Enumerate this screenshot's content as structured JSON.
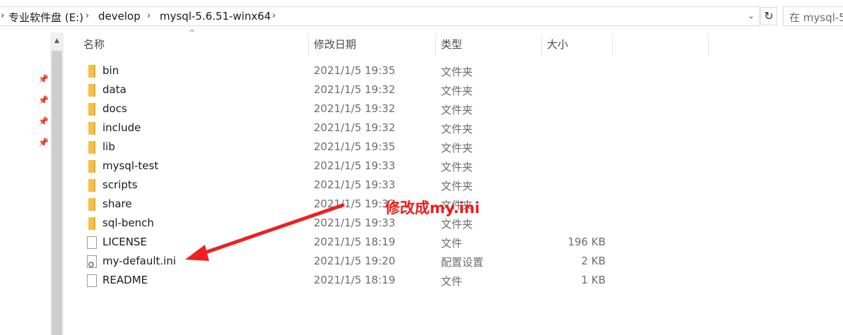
{
  "breadcrumb": {
    "items": [
      "专业软件盘 (E:)",
      "develop",
      "mysql-5.6.51-winx64"
    ]
  },
  "search": {
    "placeholder": "在 mysql-5"
  },
  "columns": {
    "name": "名称",
    "date": "修改日期",
    "type": "类型",
    "size": "大小"
  },
  "rows": [
    {
      "name": "bin",
      "date": "2021/1/5 19:35",
      "type": "文件夹",
      "size": "",
      "icon": "folder-icon"
    },
    {
      "name": "data",
      "date": "2021/1/5 19:32",
      "type": "文件夹",
      "size": "",
      "icon": "folder-icon"
    },
    {
      "name": "docs",
      "date": "2021/1/5 19:32",
      "type": "文件夹",
      "size": "",
      "icon": "folder-icon"
    },
    {
      "name": "include",
      "date": "2021/1/5 19:32",
      "type": "文件夹",
      "size": "",
      "icon": "folder-icon"
    },
    {
      "name": "lib",
      "date": "2021/1/5 19:35",
      "type": "文件夹",
      "size": "",
      "icon": "folder-icon"
    },
    {
      "name": "mysql-test",
      "date": "2021/1/5 19:33",
      "type": "文件夹",
      "size": "",
      "icon": "folder-icon"
    },
    {
      "name": "scripts",
      "date": "2021/1/5 19:33",
      "type": "文件夹",
      "size": "",
      "icon": "folder-icon"
    },
    {
      "name": "share",
      "date": "2021/1/5 19:33",
      "type": "文件夹",
      "size": "",
      "icon": "folder-icon"
    },
    {
      "name": "sql-bench",
      "date": "2021/1/5 19:33",
      "type": "文件夹",
      "size": "",
      "icon": "folder-icon"
    },
    {
      "name": "LICENSE",
      "date": "2021/1/5 18:19",
      "type": "文件",
      "size": "196 KB",
      "icon": "file-icon"
    },
    {
      "name": "my-default.ini",
      "date": "2021/1/5 19:20",
      "type": "配置设置",
      "size": "2 KB",
      "icon": "ini-settings-icon"
    },
    {
      "name": "README",
      "date": "2021/1/5 18:19",
      "type": "文件",
      "size": "1 KB",
      "icon": "file-icon"
    }
  ],
  "annotation": {
    "text": "修改成my.ini",
    "color": "#f01a1a"
  }
}
